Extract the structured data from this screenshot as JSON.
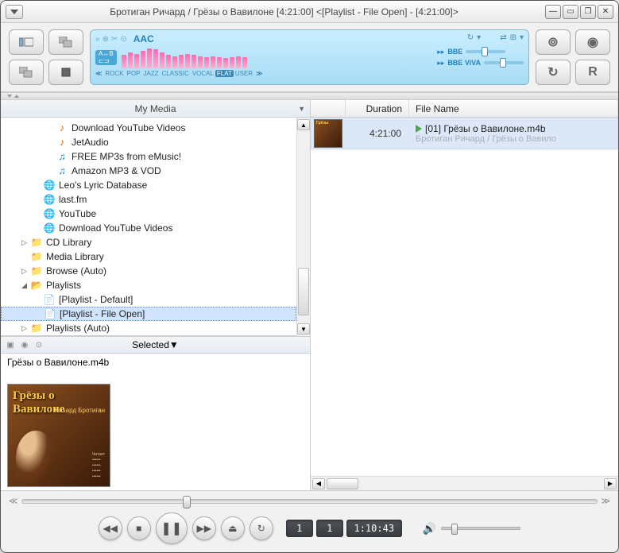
{
  "titlebar": {
    "full_title": "Бротиган Ричард / Грёзы о Вавилоне  [4:21:00]    <[Playlist - File Open] - [4:21:00]>"
  },
  "display": {
    "codec": "AAC",
    "presets": [
      "ROCK",
      "POP",
      "JAZZ",
      "CLASSIC",
      "VOCAL",
      "FLAT",
      "USER"
    ],
    "active_preset": "FLAT",
    "bbe_label": "BBE",
    "viva_label": "BBE ViVA"
  },
  "left_header": "My Media",
  "tree": [
    {
      "indent": 3,
      "icon": "note",
      "label": "Download YouTube Videos"
    },
    {
      "indent": 3,
      "icon": "note",
      "label": "JetAudio"
    },
    {
      "indent": 3,
      "icon": "note2",
      "label": "FREE MP3s from eMusic!"
    },
    {
      "indent": 3,
      "icon": "note2",
      "label": "Amazon MP3 & VOD"
    },
    {
      "indent": 2,
      "icon": "globe",
      "label": "Leo's Lyric Database"
    },
    {
      "indent": 2,
      "icon": "globe",
      "label": "last.fm"
    },
    {
      "indent": 2,
      "icon": "globe",
      "label": "YouTube"
    },
    {
      "indent": 2,
      "icon": "globe",
      "label": "Download YouTube Videos"
    },
    {
      "indent": 1,
      "expand": "▷",
      "icon": "folder",
      "label": "CD Library"
    },
    {
      "indent": 1,
      "icon": "folder",
      "label": "Media Library"
    },
    {
      "indent": 1,
      "expand": "▷",
      "icon": "folder",
      "label": "Browse (Auto)"
    },
    {
      "indent": 1,
      "expand": "◢",
      "icon": "folder-open",
      "label": "Playlists"
    },
    {
      "indent": 2,
      "icon": "doc",
      "label": "[Playlist - Default]"
    },
    {
      "indent": 2,
      "icon": "doc",
      "label": "[Playlist - File Open]",
      "selected": true
    },
    {
      "indent": 1,
      "expand": "▷",
      "icon": "folder",
      "label": "Playlists (Auto)"
    }
  ],
  "selected_header": "Selected",
  "selected_file": "Грёзы о Вавилоне.m4b",
  "album": {
    "title": "Грёзы о Вавилоне",
    "author": "Ричард Бротиган"
  },
  "columns": {
    "duration": "Duration",
    "filename": "File Name"
  },
  "rows": [
    {
      "duration": "4:21:00",
      "name": "[01] Грёзы о Вавилоне.m4b",
      "sub": "Бротиган Ричард / Грёзы о Вавило"
    }
  ],
  "playback": {
    "track_cur": "1",
    "track_total": "1",
    "time": "1:10:43"
  }
}
